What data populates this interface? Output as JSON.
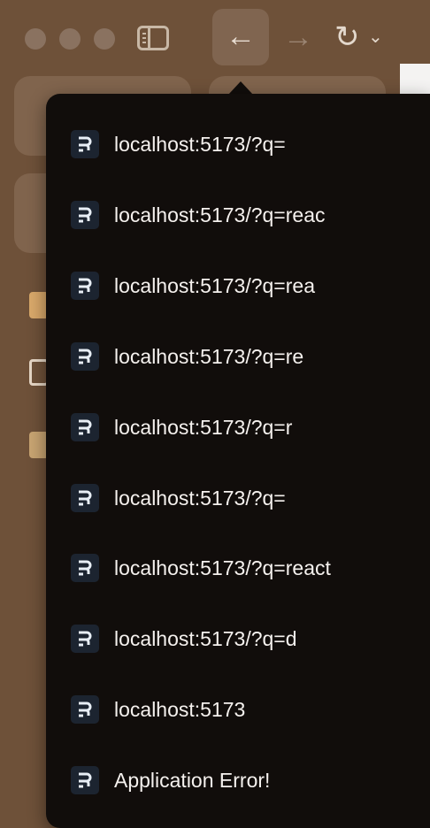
{
  "toolbar": {
    "back_icon": "arrow-left-icon",
    "forward_icon": "arrow-right-icon",
    "reload_icon": "reload-icon",
    "sidebar_icon": "sidebar-icon"
  },
  "history_menu": {
    "items": [
      {
        "label": "localhost:5173/?q=",
        "icon": "remix-favicon"
      },
      {
        "label": "localhost:5173/?q=reac",
        "icon": "remix-favicon"
      },
      {
        "label": "localhost:5173/?q=rea",
        "icon": "remix-favicon"
      },
      {
        "label": "localhost:5173/?q=re",
        "icon": "remix-favicon"
      },
      {
        "label": "localhost:5173/?q=r",
        "icon": "remix-favicon"
      },
      {
        "label": "localhost:5173/?q=",
        "icon": "remix-favicon"
      },
      {
        "label": "localhost:5173/?q=react",
        "icon": "remix-favicon"
      },
      {
        "label": "localhost:5173/?q=d",
        "icon": "remix-favicon"
      },
      {
        "label": "localhost:5173",
        "icon": "remix-favicon"
      },
      {
        "label": "Application Error!",
        "icon": "remix-favicon"
      }
    ]
  },
  "colors": {
    "window_bg": "#6e5139",
    "menu_bg": "#110d0b",
    "menu_text": "#f5f1ee",
    "favicon_bg": "#1c2430"
  }
}
